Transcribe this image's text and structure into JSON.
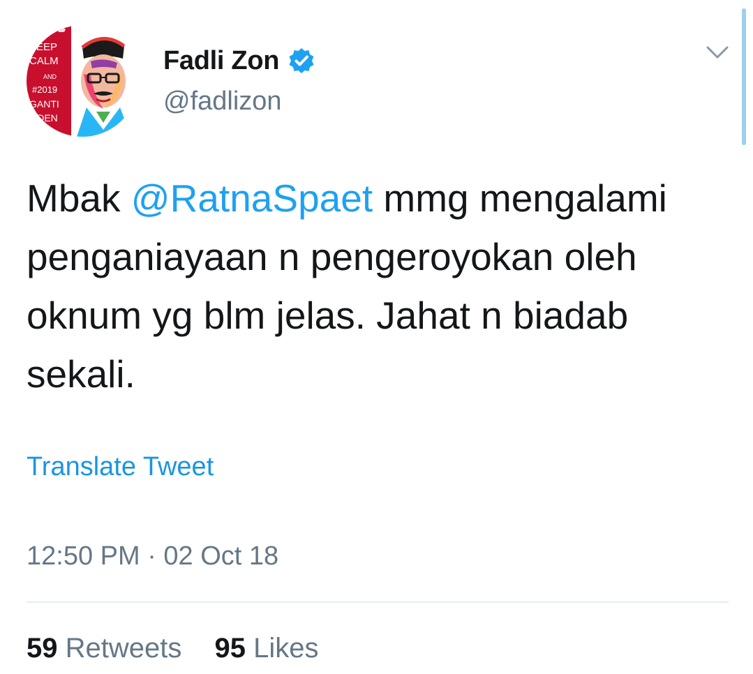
{
  "author": {
    "display_name": "Fadli Zon",
    "handle": "@fadlizon",
    "verified_icon": "verified-badge-icon",
    "avatar_text": [
      "KEEP",
      "CALM",
      "AND",
      "#2019",
      "GANTI",
      "SIDEN"
    ]
  },
  "menu": {
    "icon": "chevron-down-icon"
  },
  "tweet": {
    "text_before": "Mbak ",
    "mention": "@RatnaSpaet",
    "text_after": " mmg mengalami penganiayaan n pengeroyokan oleh oknum yg blm jelas. Jahat n biadab sekali.",
    "translate_label": "Translate Tweet",
    "timestamp": "12:50 PM · 02 Oct 18"
  },
  "stats": {
    "retweets_count": "59",
    "retweets_label": "Retweets",
    "likes_count": "95",
    "likes_label": "Likes"
  },
  "colors": {
    "link_blue": "#1da1f2",
    "text_dark": "#14171a",
    "text_gray": "#657786",
    "avatar_red": "#c8102e",
    "verified_blue": "#1da1f2"
  }
}
